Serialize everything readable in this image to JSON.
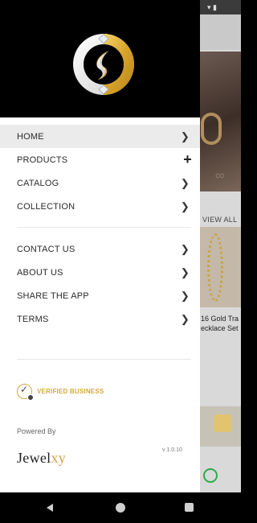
{
  "menu_primary": [
    {
      "label": "HOME",
      "indicator": "chevron-right",
      "active": true
    },
    {
      "label": "PRODUCTS",
      "indicator": "plus"
    },
    {
      "label": "CATALOG",
      "indicator": "chevron-right"
    },
    {
      "label": "COLLECTION",
      "indicator": "chevron-right"
    }
  ],
  "menu_secondary": [
    {
      "label": "CONTACT US",
      "indicator": "chevron-right"
    },
    {
      "label": "ABOUT US",
      "indicator": "chevron-right"
    },
    {
      "label": "SHARE THE APP",
      "indicator": "chevron-right"
    },
    {
      "label": "TERMS",
      "indicator": "chevron-right"
    }
  ],
  "verified": {
    "label": "VERIFIED BUSINESS",
    "icon": "verified-check-icon"
  },
  "footer": {
    "powered_by": "Powered By",
    "brand_main": "Jewel",
    "brand_accent": "xy",
    "version": "v 1.0.10"
  },
  "background": {
    "view_all": "VIEW ALL",
    "product_line1": "16 Gold Tra",
    "product_line2": "ecklace Set"
  },
  "colors": {
    "accent_gold": "#d4a93a",
    "drawer_header": "#000000",
    "active_row": "#ebebeb"
  }
}
